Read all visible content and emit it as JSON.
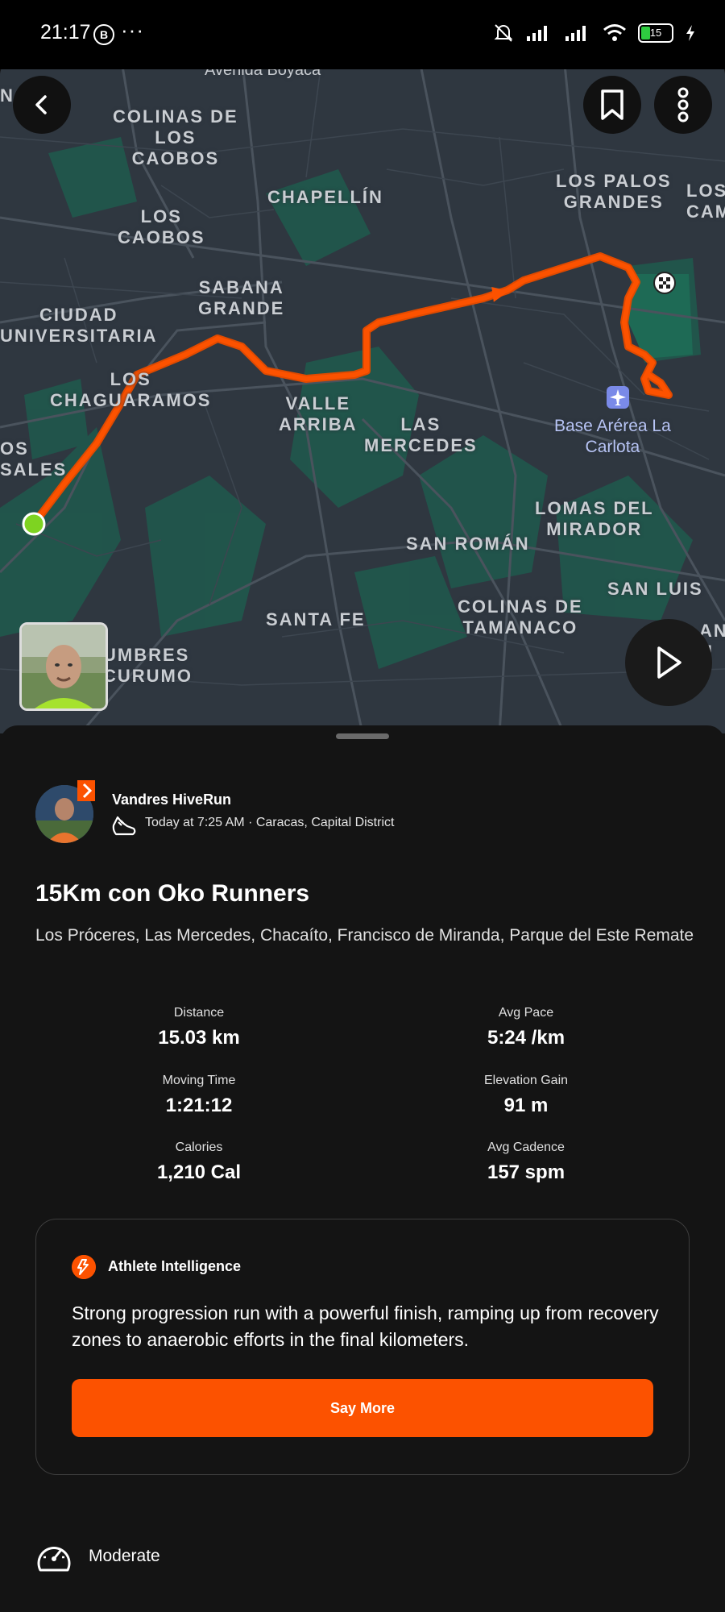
{
  "status_bar": {
    "time": "21:17",
    "b_label": "B",
    "dots": "···",
    "battery": "15"
  },
  "map": {
    "labels": {
      "avenida_boyaca": "Avenida Boyacá",
      "colinas_de_los_caobos": "COLINAS DE\nLOS\nCAOBOS",
      "chapellin": "CHAPELLÍN",
      "los_palos_grandes": "LOS PALOS\nGRANDES",
      "los_cam": "LOS\nCAM",
      "los_caobos": "LOS\nCAOBOS",
      "sabana_grande": "SABANA\nGRANDE",
      "ciudad_universitaria": "CIUDAD\nUNIVERSITARIA",
      "los_chaguaramos": "LOS\nCHAGUARAMOS",
      "valle_arriba": "VALLE\nARRIBA",
      "las_mercedes": "LAS\nMERCEDES",
      "base_aerea": "Base Arérea La\nCarlota",
      "os_sales": "OS\nSALES",
      "lomas_del_mirador": "LOMAS DEL\nMIRADOR",
      "san_roman": "SAN ROMÁN",
      "san_luis": "SAN LUIS",
      "colinas_de_tamanaco": "COLINAS DE\nTAMANACO",
      "santa_fe": "SANTA FE",
      "umbres_curumo": "UMBRES\nCURUMO",
      "an_u": "AN\nU",
      "n_edge": "N"
    }
  },
  "activity": {
    "athlete_name": "Vandres HiveRun",
    "meta": "Today at 7:25 AM · Caracas, Capital District",
    "title": "15Km con Oko Runners",
    "description": "Los Próceres, Las Mercedes, Chacaíto, Francisco de Miranda, Parque del Este Remate"
  },
  "stats": {
    "distance": {
      "label": "Distance",
      "value": "15.03 km"
    },
    "avg_pace": {
      "label": "Avg Pace",
      "value": "5:24 /km"
    },
    "moving_time": {
      "label": "Moving Time",
      "value": "1:21:12"
    },
    "elevation_gain": {
      "label": "Elevation Gain",
      "value": "91 m"
    },
    "calories": {
      "label": "Calories",
      "value": "1,210 Cal"
    },
    "avg_cadence": {
      "label": "Avg Cadence",
      "value": "157 spm"
    }
  },
  "athlete_intelligence": {
    "title": "Athlete Intelligence",
    "text": "Strong progression run with a powerful finish, ramping up from recovery zones to anaerobic efforts in the final kilometers.",
    "button_label": "Say More"
  },
  "effort": {
    "label": "Moderate"
  },
  "colors": {
    "accent": "#fc5200",
    "route": "#fc5200",
    "start_marker": "#7ed321",
    "background": "#141414"
  },
  "icons": [
    "back-icon",
    "bookmark-icon",
    "more-vertical-icon",
    "play-icon",
    "airport-icon",
    "finish-flag-icon",
    "shoe-icon",
    "strava-badge-icon",
    "athlete-intelligence-icon",
    "gauge-icon"
  ]
}
